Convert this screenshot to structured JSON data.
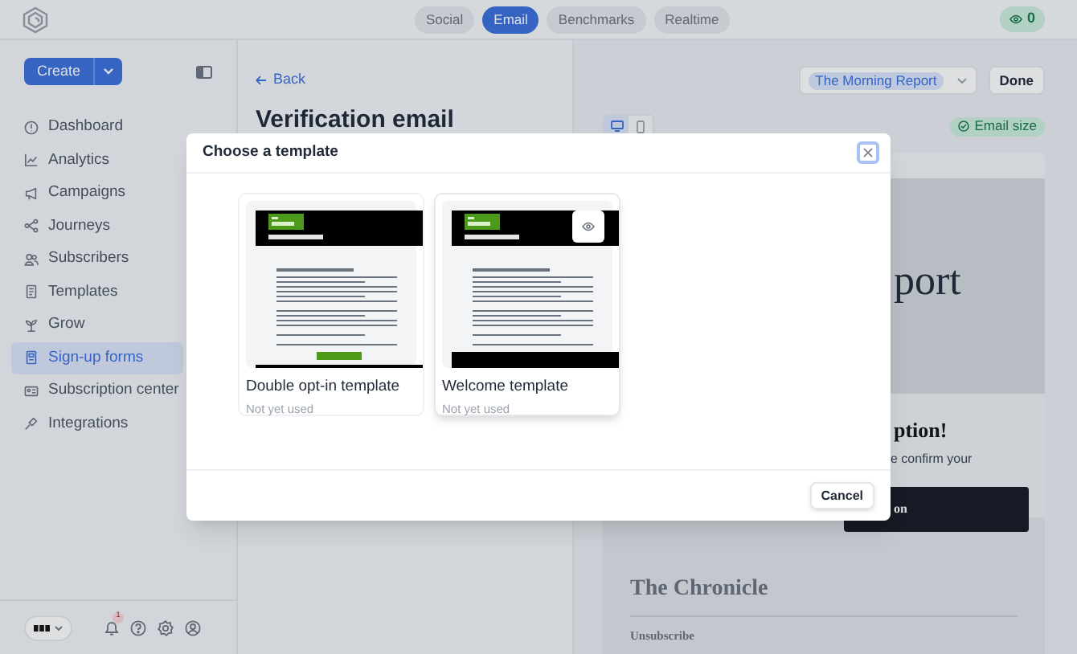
{
  "top_bar": {
    "tabs": [
      {
        "label": "Social",
        "selected": false
      },
      {
        "label": "Email",
        "selected": true
      },
      {
        "label": "Benchmarks",
        "selected": false
      },
      {
        "label": "Realtime",
        "selected": false
      }
    ],
    "viewers": "0"
  },
  "sidebar": {
    "create_button": "Create",
    "nav": [
      {
        "label": "Dashboard",
        "kind": "dashboard",
        "selected": false
      },
      {
        "label": "Analytics",
        "kind": "analytics",
        "selected": false
      },
      {
        "label": "Campaigns",
        "kind": "campaigns",
        "selected": false
      },
      {
        "label": "Journeys",
        "kind": "journeys",
        "selected": false
      },
      {
        "label": "Subscribers",
        "kind": "subscribers",
        "selected": false
      },
      {
        "label": "Templates",
        "kind": "templates",
        "selected": false
      },
      {
        "label": "Grow",
        "kind": "grow",
        "selected": false
      },
      {
        "label": "Sign-up forms",
        "kind": "forms",
        "selected": true
      },
      {
        "label": "Subscription center",
        "kind": "center",
        "selected": false
      },
      {
        "label": "Integrations",
        "kind": "integrations",
        "selected": false
      }
    ],
    "notification_count": "1"
  },
  "main": {
    "back": "Back",
    "title": "Verification email"
  },
  "editor": {
    "newsletter": "The Morning Report",
    "done": "Done",
    "devices": [
      {
        "kind": "desktop",
        "selected": true
      },
      {
        "kind": "mobile",
        "selected": false
      }
    ],
    "email_size": "Email size",
    "preview": {
      "heading_fragment": "port",
      "title_fragment": "ption!",
      "text_fragment": "e confirm your",
      "button_fragment": "on",
      "footer_title": "The Chronicle",
      "footer_link": "Unsubscribe"
    }
  },
  "modal": {
    "title": "Choose a template",
    "templates": [
      {
        "name": "Double opt-in template",
        "status": "Not yet used",
        "kind": "double_opt_in",
        "hovered": false
      },
      {
        "name": "Welcome template",
        "status": "Not yet used",
        "kind": "welcome",
        "hovered": true
      }
    ],
    "cancel": "Cancel"
  }
}
